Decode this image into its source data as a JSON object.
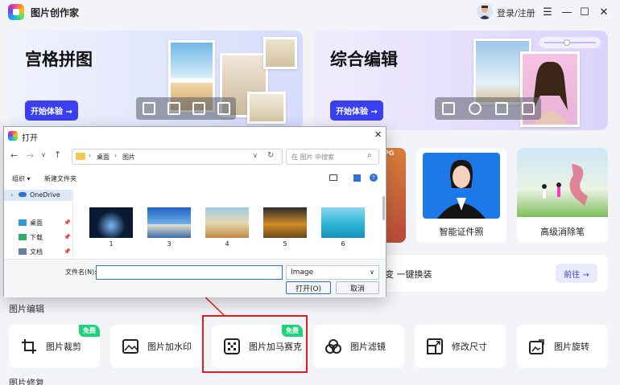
{
  "app": {
    "title": "图片创作家",
    "login": "登录/注册"
  },
  "banners": [
    {
      "title": "宫格拼图",
      "button": "开始体验 →"
    },
    {
      "title": "综合编辑",
      "button": "开始体验 →"
    }
  ],
  "features": [
    {
      "label": "智能证件照"
    },
    {
      "label": "高级消除笔"
    }
  ],
  "feature_badge": "JPG",
  "promo": {
    "text": "变 一键换装",
    "button": "前往 →"
  },
  "sections": {
    "edit": "图片编辑",
    "repair": "图片修复"
  },
  "tools": [
    {
      "label": "图片裁剪",
      "badge": "免费",
      "icon": "crop-icon"
    },
    {
      "label": "图片加水印",
      "badge": "",
      "icon": "watermark-icon"
    },
    {
      "label": "图片加马赛克",
      "badge": "免费",
      "icon": "mosaic-icon"
    },
    {
      "label": "图片滤镜",
      "badge": "",
      "icon": "filter-icon"
    },
    {
      "label": "修改尺寸",
      "badge": "",
      "icon": "resize-icon"
    },
    {
      "label": "图片旋转",
      "badge": "",
      "icon": "rotate-icon"
    }
  ],
  "dialog": {
    "title": "打开",
    "breadcrumb": [
      "桌面",
      "图片"
    ],
    "search_placeholder": "在 图片 中搜索",
    "organize": "组织 ▾",
    "new_folder": "新建文件夹",
    "nav": [
      "OneDrive",
      "桌面",
      "下载",
      "文档"
    ],
    "files": [
      {
        "name": "1",
        "color": "#0a1a33"
      },
      {
        "name": "3",
        "color": "#3a88d4"
      },
      {
        "name": "4",
        "color": "#b8905a"
      },
      {
        "name": "5",
        "color": "#c98a32"
      },
      {
        "name": "6",
        "color": "#2bb6d8"
      }
    ],
    "filename_label": "文件名(N):",
    "filename_value": "",
    "filetype": "Image",
    "open_button": "打开(O)",
    "cancel_button": "取消"
  },
  "colors": {
    "accent": "#3a40f0",
    "free": "#1fd37c",
    "highlight": "#e02020"
  }
}
